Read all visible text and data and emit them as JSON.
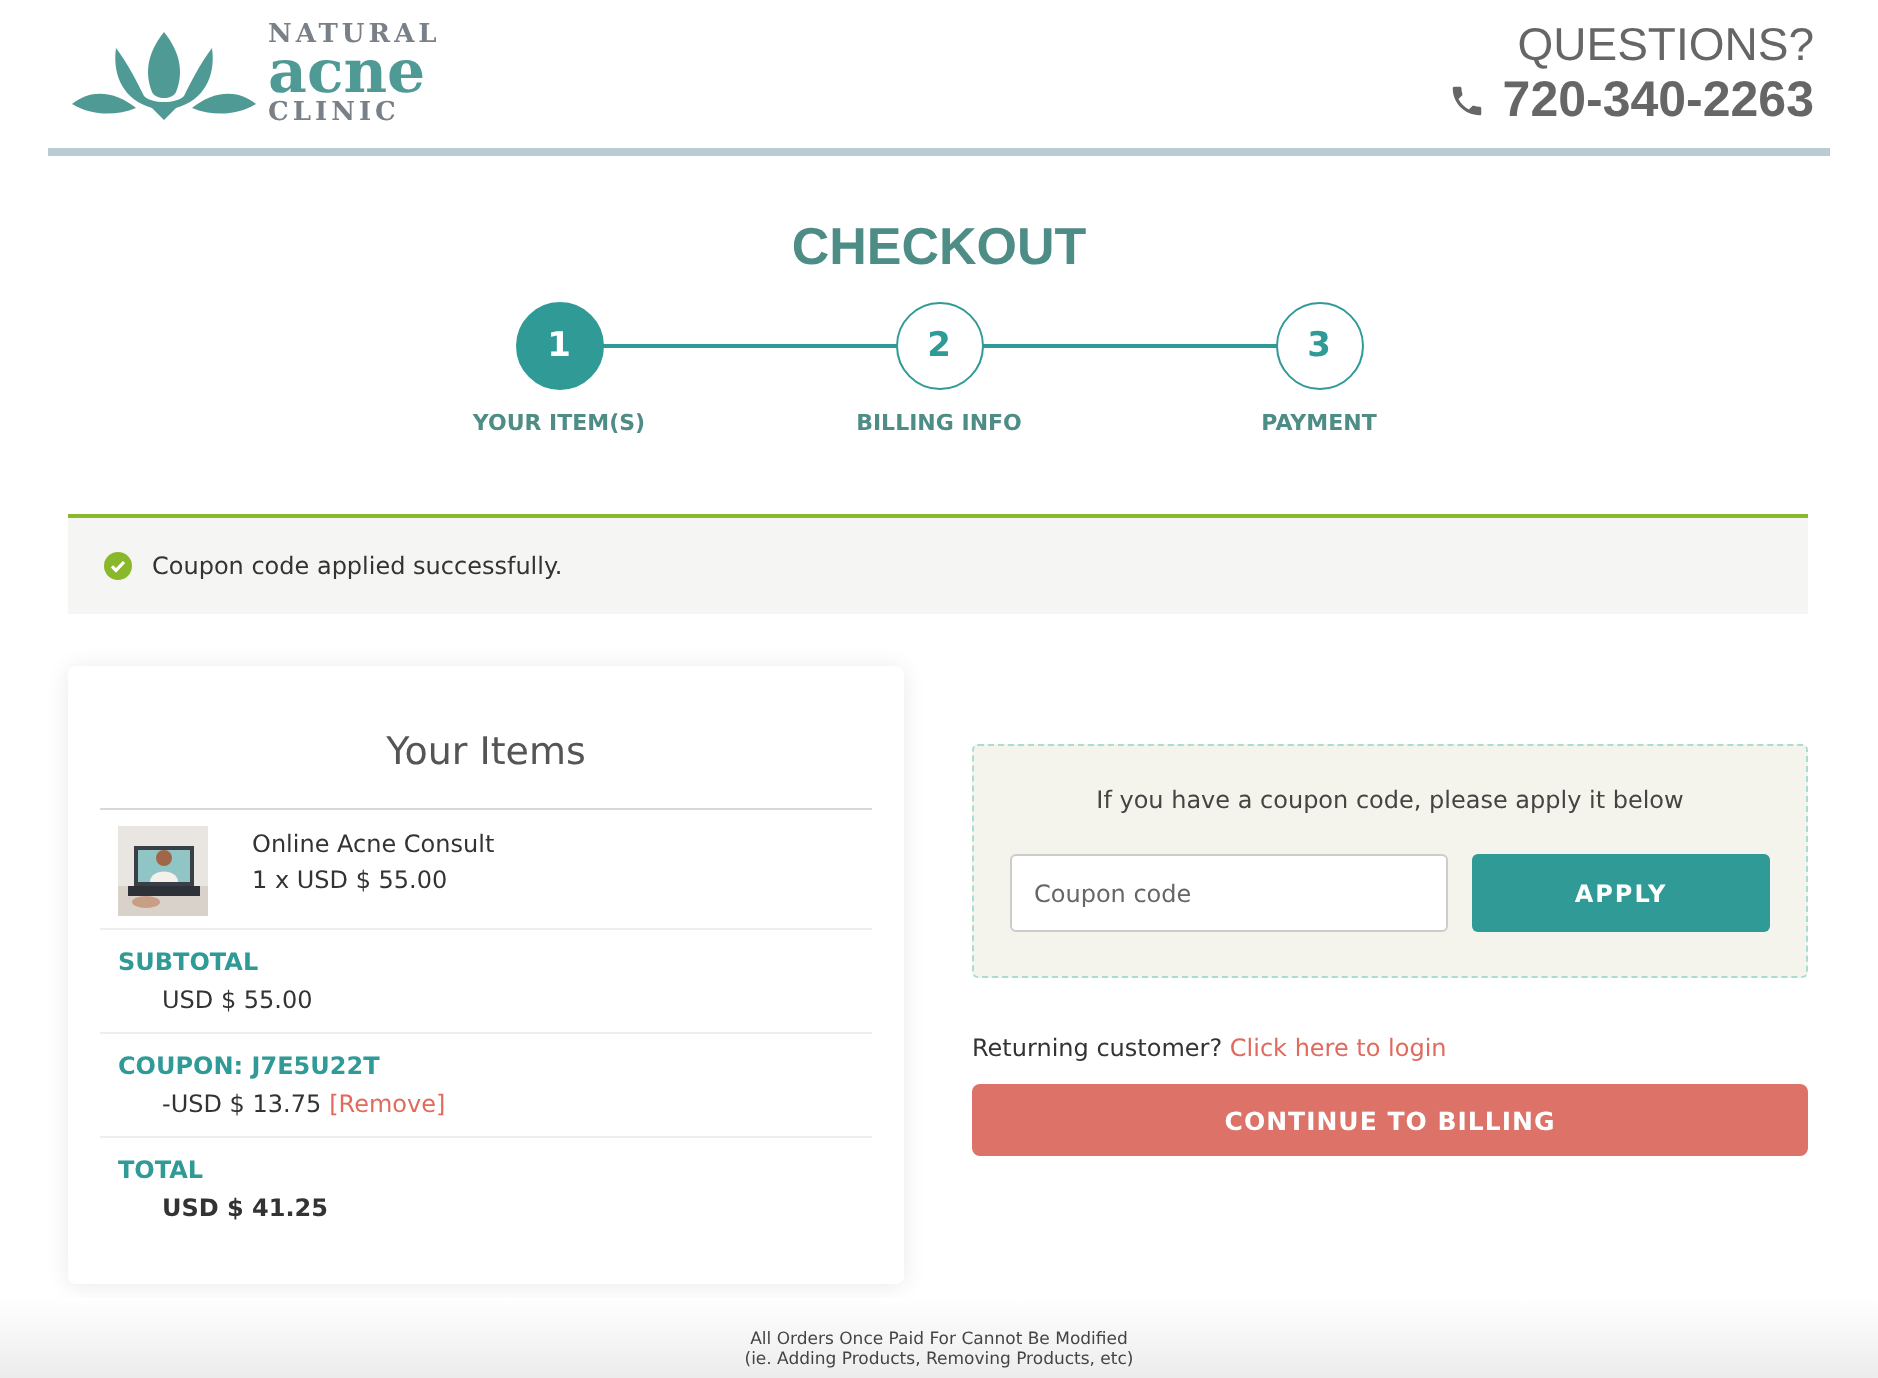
{
  "logo": {
    "top": "NATURAL",
    "middle": "acne",
    "bottom": "CLINIC"
  },
  "contact": {
    "heading": "QUESTIONS?",
    "phone": "720-340-2263"
  },
  "title": "CHECKOUT",
  "steps": [
    {
      "number": "1",
      "label": "YOUR ITEM(S)",
      "selected": true
    },
    {
      "number": "2",
      "label": "BILLING INFO",
      "selected": false
    },
    {
      "number": "3",
      "label": "PAYMENT",
      "selected": false
    }
  ],
  "alert": {
    "kind": "success",
    "message": "Coupon code applied successfully."
  },
  "items_card": {
    "title": "Your Items",
    "products": [
      {
        "name": "Online Acne Consult",
        "price": "1 x USD $ 55.00"
      }
    ],
    "summary": [
      {
        "label": "SUBTOTAL",
        "value": "USD $ 55.00",
        "bold": false
      },
      {
        "label": "COUPON: J7E5U22T",
        "value": "-USD $ 13.75",
        "bold": false,
        "action": "[Remove]"
      },
      {
        "label": "TOTAL",
        "value": "USD $ 41.25",
        "bold": true
      }
    ]
  },
  "coupon": {
    "prompt": "If you have a coupon code, please apply it below",
    "placeholder": "Coupon code",
    "button": "APPLY"
  },
  "returning": {
    "text": "Returning customer?",
    "link": "Click here to login"
  },
  "continue_button": "CONTINUE TO BILLING",
  "footer": [
    "All Orders Once Paid For Cannot Be Modified",
    "(ie. Adding Products, Removing Products, etc)"
  ]
}
